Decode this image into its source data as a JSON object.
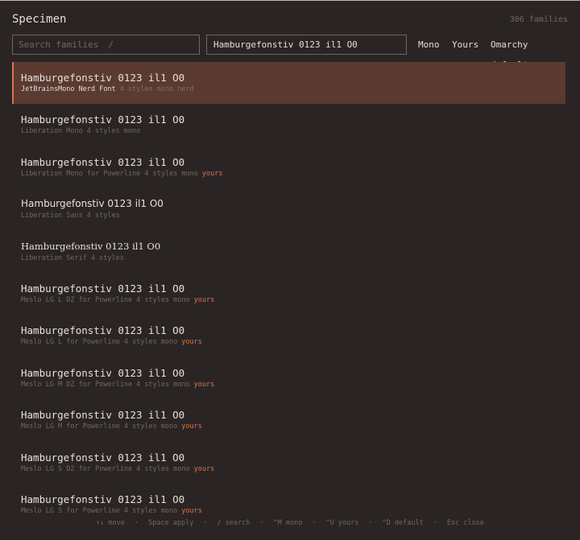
{
  "header": {
    "title": "Specimen",
    "count": "306 families"
  },
  "search": {
    "placeholder": "Search families",
    "shortcut": "/"
  },
  "preview": {
    "text": "Hamburgefonstiv 0123 il1 O0"
  },
  "filters": {
    "mono": "Mono",
    "yours": "Yours",
    "default": "Omarchy default"
  },
  "fonts": [
    {
      "sample": "Hamburgefonstiv 0123 il1 O0",
      "name": "JetBrainsMono Nerd Font",
      "styles": "4 styles",
      "tags": "mono nerd",
      "yours": ""
    },
    {
      "sample": "Hamburgefonstiv 0123 il1 O0",
      "name": "Liberation Mono",
      "styles": "4 styles",
      "tags": "mono",
      "yours": ""
    },
    {
      "sample": "Hamburgefonstiv 0123 il1 O0",
      "name": "Liberation Mono for Powerline",
      "styles": "4 styles",
      "tags": "mono",
      "yours": "yours"
    },
    {
      "sample": "Hamburgefonstiv 0123 il1 O0",
      "name": "Liberation Sans",
      "styles": "4 styles",
      "tags": "",
      "yours": ""
    },
    {
      "sample": "Hamburgefonstiv 0123 il1 O0",
      "name": "Liberation Serif",
      "styles": "4 styles",
      "tags": "",
      "yours": ""
    },
    {
      "sample": "Hamburgefonstiv 0123 il1 O0",
      "name": "Meslo LG L DZ for Powerline",
      "styles": "4 styles",
      "tags": "mono",
      "yours": "yours"
    },
    {
      "sample": "Hamburgefonstiv 0123 il1 O0",
      "name": "Meslo LG L for Powerline",
      "styles": "4 styles",
      "tags": "mono",
      "yours": "yours"
    },
    {
      "sample": "Hamburgefonstiv 0123 il1 O0",
      "name": "Meslo LG M DZ for Powerline",
      "styles": "4 styles",
      "tags": "mono",
      "yours": "yours"
    },
    {
      "sample": "Hamburgefonstiv 0123 il1 O0",
      "name": "Meslo LG M for Powerline",
      "styles": "4 styles",
      "tags": "mono",
      "yours": "yours"
    },
    {
      "sample": "Hamburgefonstiv 0123 il1 O0",
      "name": "Meslo LG S DZ for Powerline",
      "styles": "4 styles",
      "tags": "mono",
      "yours": "yours"
    },
    {
      "sample": "Hamburgefonstiv 0123 il1 O0",
      "name": "Meslo LG S for Powerline",
      "styles": "4 styles",
      "tags": "mono",
      "yours": "yours"
    }
  ],
  "footer": {
    "move": "↑↓ move",
    "apply": "Space apply",
    "search": "/ search",
    "mono": "^M mono",
    "yours": "^U yours",
    "default": "^D default",
    "close": "Esc close",
    "separator": "·"
  },
  "colors": {
    "background": "#2a2524",
    "selected_row": "#5a3a31",
    "accent": "#d9744e",
    "muted_text": "#6f6763",
    "text": "#e4dcd7"
  }
}
